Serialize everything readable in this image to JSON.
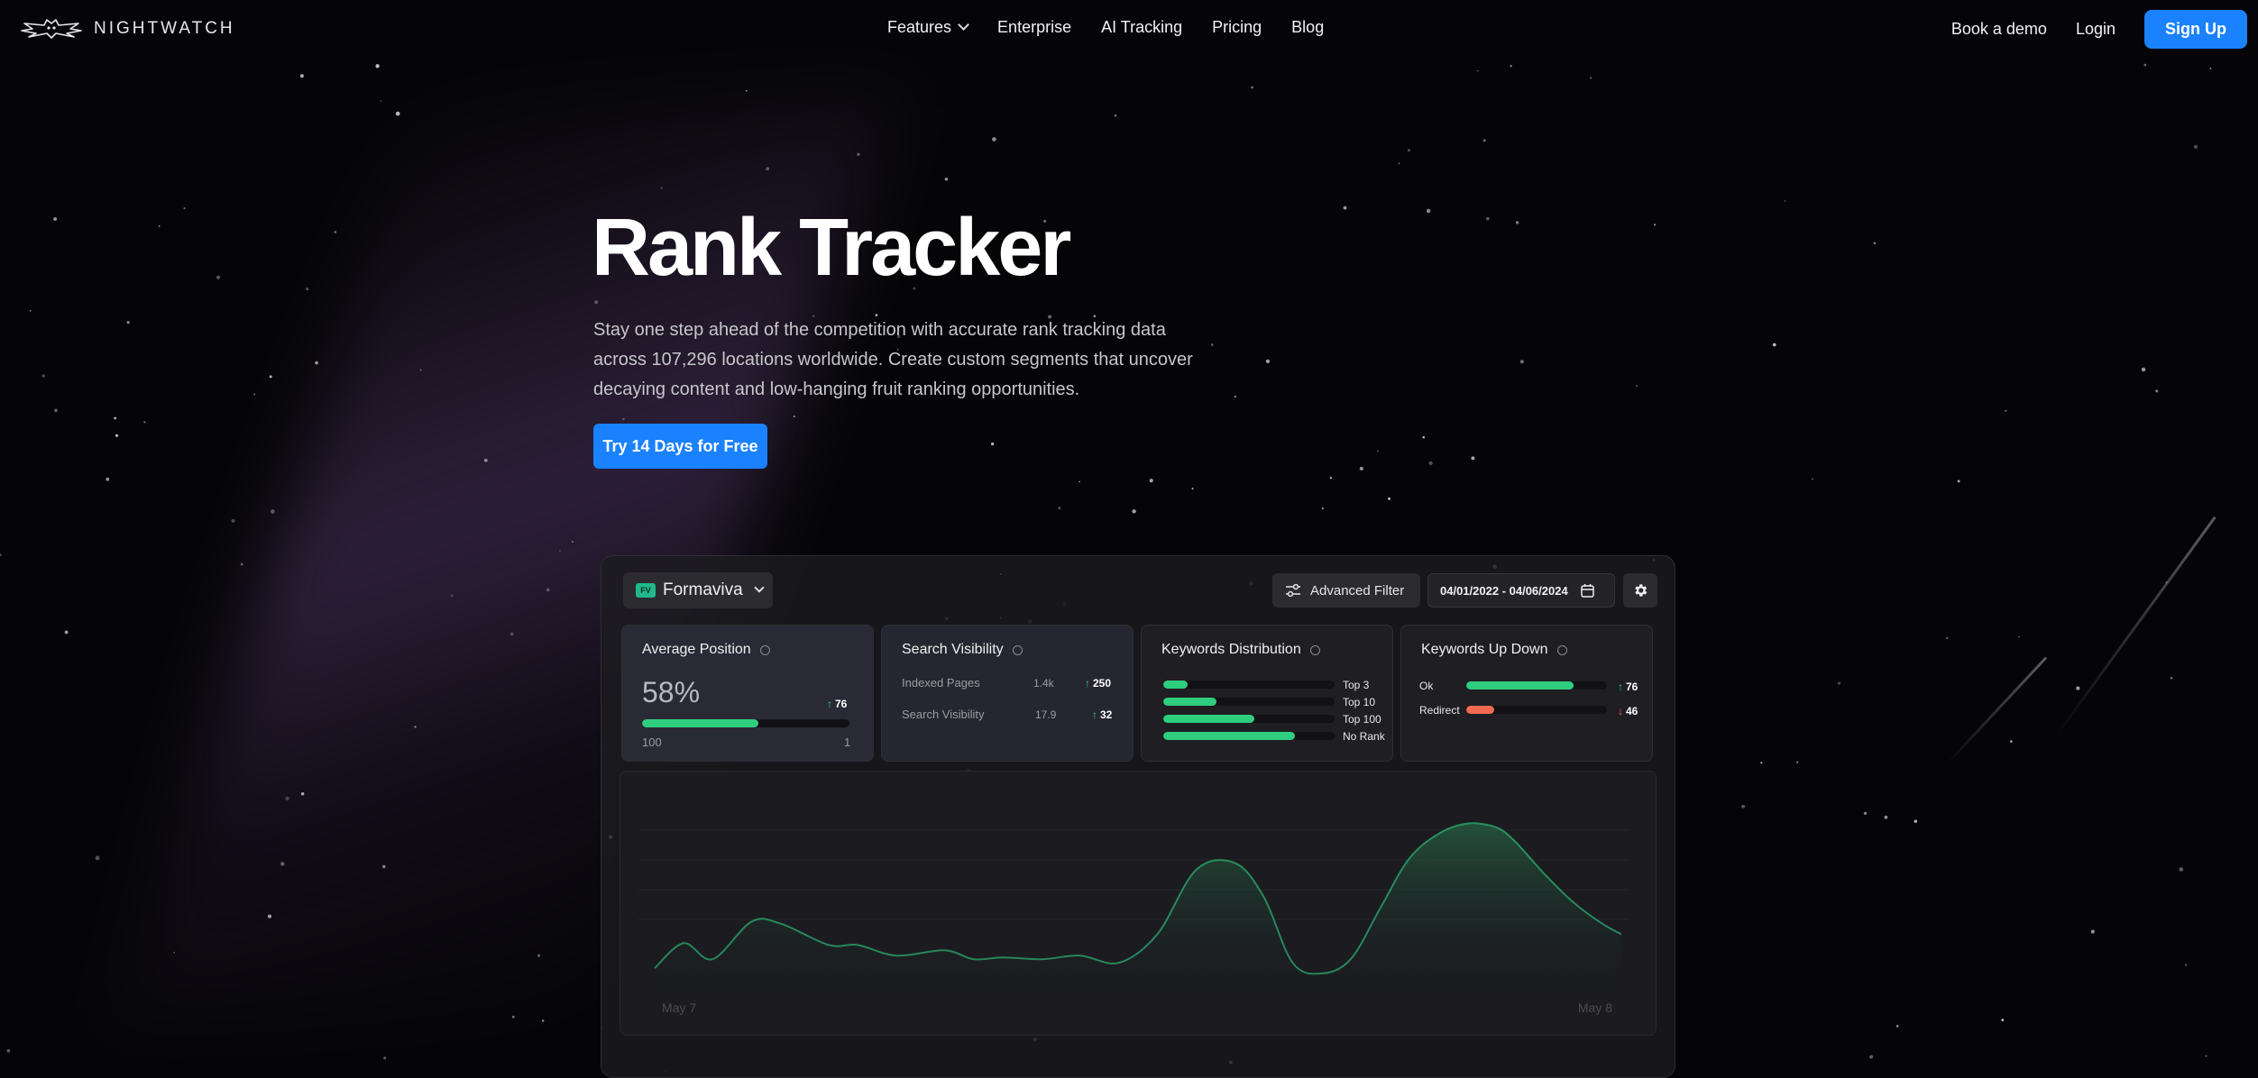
{
  "nav": {
    "brand": "NIGHTWATCH",
    "links": [
      "Features",
      "Enterprise",
      "AI Tracking",
      "Pricing",
      "Blog"
    ],
    "book_demo": "Book a demo",
    "login": "Login",
    "signup": "Sign Up"
  },
  "hero": {
    "title": "Rank Tracker",
    "subtitle": "Stay one step ahead of the competition with accurate rank tracking data across 107,296 locations worldwide. Create custom segments that uncover decaying content and low-hanging fruit ranking opportunities.",
    "cta": "Try 14 Days for Free"
  },
  "dashboard": {
    "project": {
      "badge": "FV",
      "name": "Formaviva"
    },
    "advanced_filter": "Advanced Filter",
    "date_range": "04/01/2022 - 04/06/2024",
    "cards": {
      "average_position": {
        "title": "Average Position",
        "value": "58%",
        "change": "76",
        "progress": 0.56,
        "min_label": "100",
        "max_label": "1"
      },
      "search_visibility": {
        "title": "Search Visibility",
        "rows": [
          {
            "label": "Indexed Pages",
            "value": "1.4k",
            "change": "250"
          },
          {
            "label": "Search Visibility",
            "value": "17.9",
            "change": "32"
          }
        ]
      },
      "keywords_distribution": {
        "title": "Keywords Distribution",
        "rows": [
          {
            "label": "Top 3",
            "fraction": 0.14
          },
          {
            "label": "Top 10",
            "fraction": 0.31
          },
          {
            "label": "Top 100",
            "fraction": 0.53
          },
          {
            "label": "No Rank",
            "fraction": 0.77
          }
        ]
      },
      "keywords_up_down": {
        "title": "Keywords Up Down",
        "rows": [
          {
            "label": "Ok",
            "fraction": 0.76,
            "change": "76",
            "direction": "up"
          },
          {
            "label": "Redirect",
            "fraction": 0.2,
            "change": "46",
            "direction": "down"
          }
        ]
      }
    },
    "chart": {
      "x_start_label": "May 7",
      "x_end_label": "May 8"
    }
  },
  "chart_data": {
    "type": "area",
    "x": [
      0,
      0.03,
      0.06,
      0.1,
      0.13,
      0.18,
      0.21,
      0.25,
      0.3,
      0.33,
      0.36,
      0.4,
      0.44,
      0.48,
      0.52,
      0.56,
      0.6,
      0.63,
      0.66,
      0.69,
      0.72,
      0.75,
      0.78,
      0.81,
      0.84,
      0.87,
      0.89,
      0.92,
      0.95,
      0.98,
      1
    ],
    "values": [
      5,
      19,
      10,
      31,
      30,
      18,
      18,
      12,
      15,
      10,
      11,
      10,
      12,
      8,
      24,
      60,
      64,
      45,
      8,
      2,
      10,
      38,
      66,
      80,
      86,
      84,
      76,
      58,
      42,
      30,
      24
    ],
    "x_tick_labels": [
      "May 7",
      "May 8"
    ],
    "colors": {
      "line": "#2fce7f",
      "fill": "#1f5f3f"
    }
  },
  "colors": {
    "accent": "#1a82ff",
    "positive": "#2fce7f",
    "negative": "#f26a52"
  }
}
